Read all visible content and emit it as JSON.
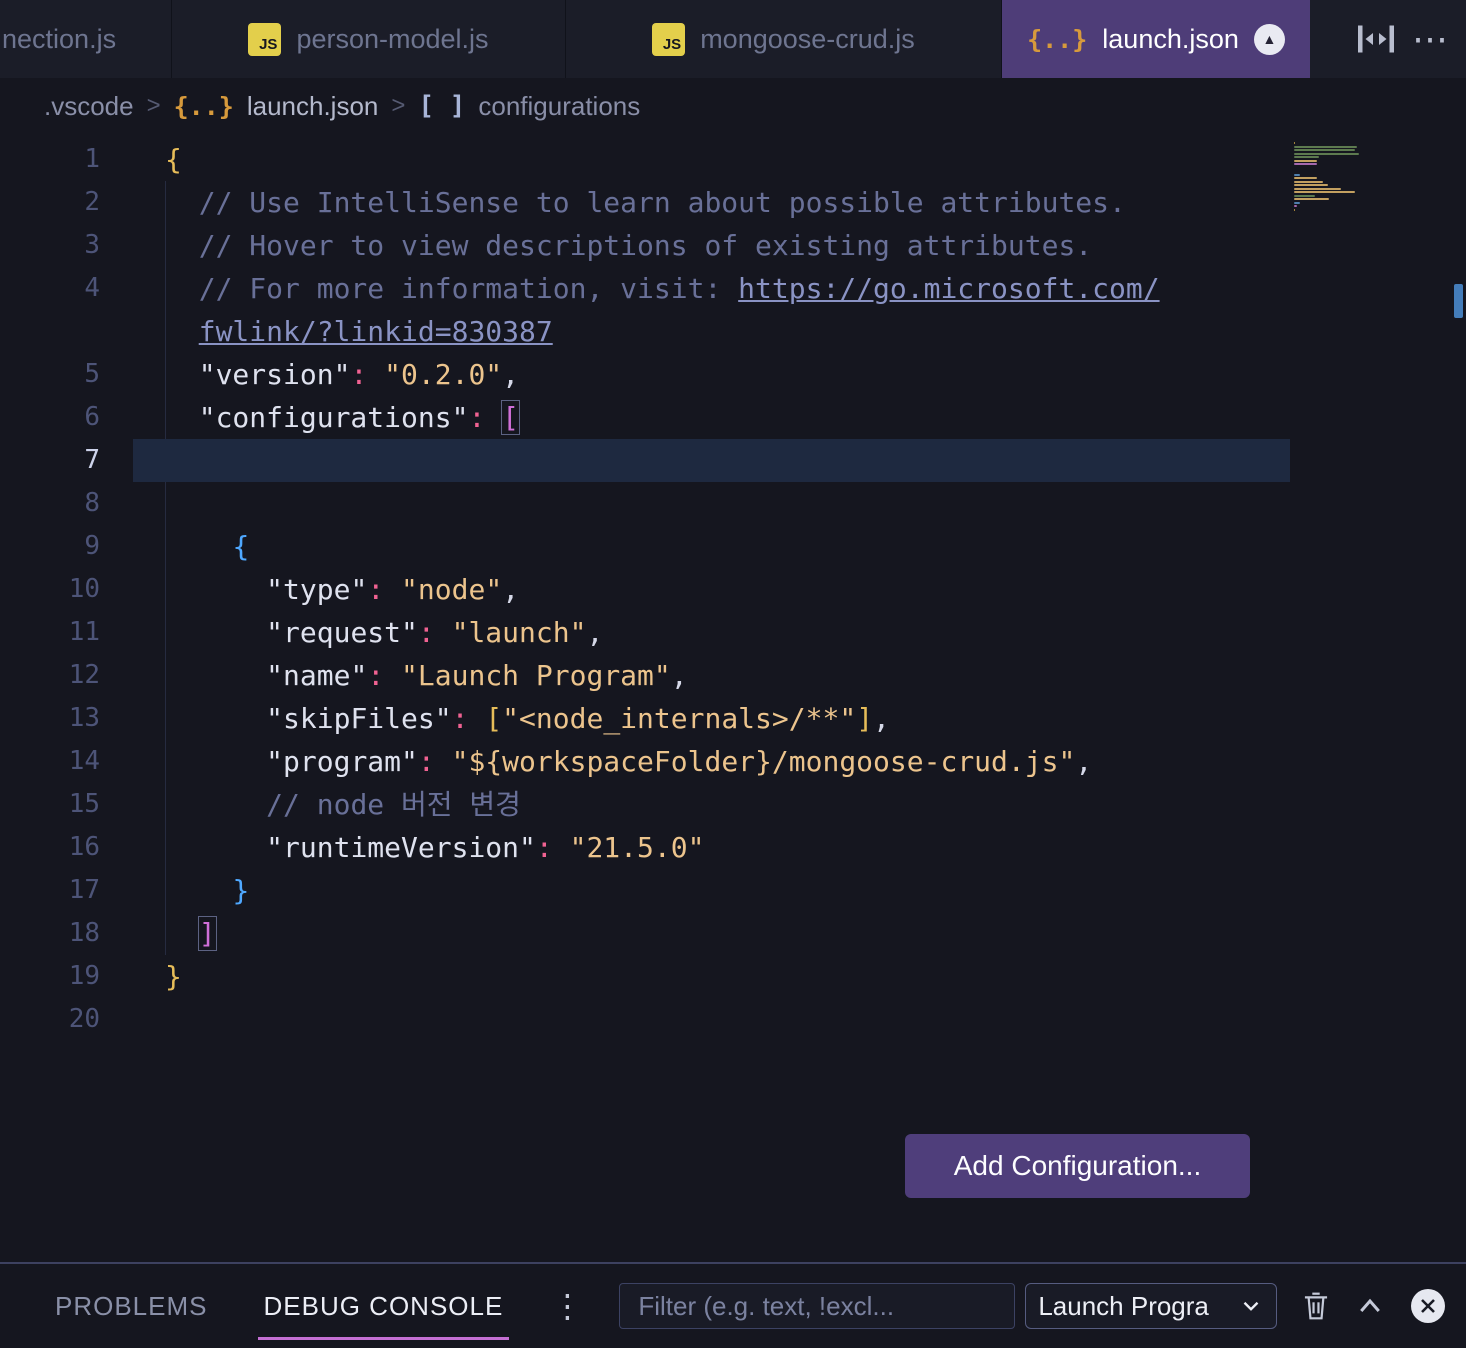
{
  "colors": {
    "accent_purple": "#4e3d78",
    "editor_bg": "#15161f",
    "tab_bar_bg": "#1b1d28",
    "string_color": "#ecc48d",
    "comment_color": "#697098",
    "debug_underline": "#c46fd3",
    "current_line_bg": "#1e2940"
  },
  "icons": {
    "js_badge": "JS",
    "json_glyph": "{..}",
    "tab_circle": "▲",
    "kebab": "⋮",
    "more": "⋯"
  },
  "tab_bar": {
    "tabs": [
      {
        "label": "nection.js"
      },
      {
        "label": "person-model.js"
      },
      {
        "label": "mongoose-crud.js"
      },
      {
        "label": "launch.json",
        "active": true
      }
    ]
  },
  "breadcrumb": {
    "folder": ".vscode",
    "separator": ">",
    "file": "launch.json",
    "symbol_icon_glyph": "[ ]",
    "symbol": "configurations"
  },
  "editor": {
    "add_configuration_label": "Add Configuration...",
    "rows": [
      {
        "n": "1",
        "tokens": [
          [
            "b1",
            "{"
          ]
        ]
      },
      {
        "n": "2",
        "tokens": [
          [
            "pun",
            "  "
          ],
          [
            "com",
            "// Use IntelliSense to learn about possible attributes."
          ]
        ]
      },
      {
        "n": "3",
        "tokens": [
          [
            "pun",
            "  "
          ],
          [
            "com",
            "// Hover to view descriptions of existing attributes."
          ]
        ]
      },
      {
        "n": "4",
        "tokens": [
          [
            "pun",
            "  "
          ],
          [
            "com",
            "// For more information, visit: "
          ],
          [
            "url",
            "https://go.microsoft.com/"
          ]
        ]
      },
      {
        "n": "",
        "tokens": [
          [
            "pun",
            "  "
          ],
          [
            "url",
            "fwlink/?linkid=830387"
          ]
        ]
      },
      {
        "n": "5",
        "tokens": [
          [
            "pun",
            "  "
          ],
          [
            "key",
            "\"version\""
          ],
          [
            "colon",
            ":"
          ],
          [
            "pun",
            " "
          ],
          [
            "str",
            "\"0.2.0\""
          ],
          [
            "pun",
            ","
          ]
        ]
      },
      {
        "n": "6",
        "tokens": [
          [
            "pun",
            "  "
          ],
          [
            "key",
            "\"configurations\""
          ],
          [
            "colon",
            ":"
          ],
          [
            "pun",
            " "
          ],
          [
            "b2",
            "[",
            1
          ]
        ]
      },
      {
        "n": "7",
        "hl": 1,
        "tokens": []
      },
      {
        "n": "8",
        "tokens": []
      },
      {
        "n": "9",
        "tokens": [
          [
            "pun",
            "    "
          ],
          [
            "b3",
            "{"
          ]
        ]
      },
      {
        "n": "10",
        "tokens": [
          [
            "pun",
            "      "
          ],
          [
            "key",
            "\"type\""
          ],
          [
            "colon",
            ":"
          ],
          [
            "pun",
            " "
          ],
          [
            "str",
            "\"node\""
          ],
          [
            "pun",
            ","
          ]
        ]
      },
      {
        "n": "11",
        "tokens": [
          [
            "pun",
            "      "
          ],
          [
            "key",
            "\"request\""
          ],
          [
            "colon",
            ":"
          ],
          [
            "pun",
            " "
          ],
          [
            "str",
            "\"launch\""
          ],
          [
            "pun",
            ","
          ]
        ]
      },
      {
        "n": "12",
        "tokens": [
          [
            "pun",
            "      "
          ],
          [
            "key",
            "\"name\""
          ],
          [
            "colon",
            ":"
          ],
          [
            "pun",
            " "
          ],
          [
            "str",
            "\"Launch Program\""
          ],
          [
            "pun",
            ","
          ]
        ]
      },
      {
        "n": "13",
        "tokens": [
          [
            "pun",
            "      "
          ],
          [
            "key",
            "\"skipFiles\""
          ],
          [
            "colon",
            ":"
          ],
          [
            "pun",
            " "
          ],
          [
            "b1",
            "["
          ],
          [
            "str",
            "\"<node_internals>/**\""
          ],
          [
            "b1",
            "]"
          ],
          [
            "pun",
            ","
          ]
        ]
      },
      {
        "n": "14",
        "tokens": [
          [
            "pun",
            "      "
          ],
          [
            "key",
            "\"program\""
          ],
          [
            "colon",
            ":"
          ],
          [
            "pun",
            " "
          ],
          [
            "str",
            "\"${workspaceFolder}/mongoose-crud.js\""
          ],
          [
            "pun",
            ","
          ]
        ]
      },
      {
        "n": "15",
        "tokens": [
          [
            "pun",
            "      "
          ],
          [
            "com",
            "// node 버전 변경"
          ]
        ]
      },
      {
        "n": "16",
        "tokens": [
          [
            "pun",
            "      "
          ],
          [
            "key",
            "\"runtimeVersion\""
          ],
          [
            "colon",
            ":"
          ],
          [
            "pun",
            " "
          ],
          [
            "str",
            "\"21.5.0\""
          ]
        ]
      },
      {
        "n": "17",
        "tokens": [
          [
            "pun",
            "    "
          ],
          [
            "b3",
            "}"
          ]
        ]
      },
      {
        "n": "18",
        "tokens": [
          [
            "pun",
            "  "
          ],
          [
            "b2",
            "]",
            1
          ]
        ]
      },
      {
        "n": "19",
        "tokens": [
          [
            "b1",
            "}"
          ]
        ]
      },
      {
        "n": "20",
        "tokens": []
      }
    ]
  },
  "panel": {
    "problems_label": "PROBLEMS",
    "debug_console_label": "DEBUG CONSOLE",
    "filter_placeholder": "Filter (e.g. text, !excl...",
    "launch_dropdown_label": "Launch Progra"
  }
}
